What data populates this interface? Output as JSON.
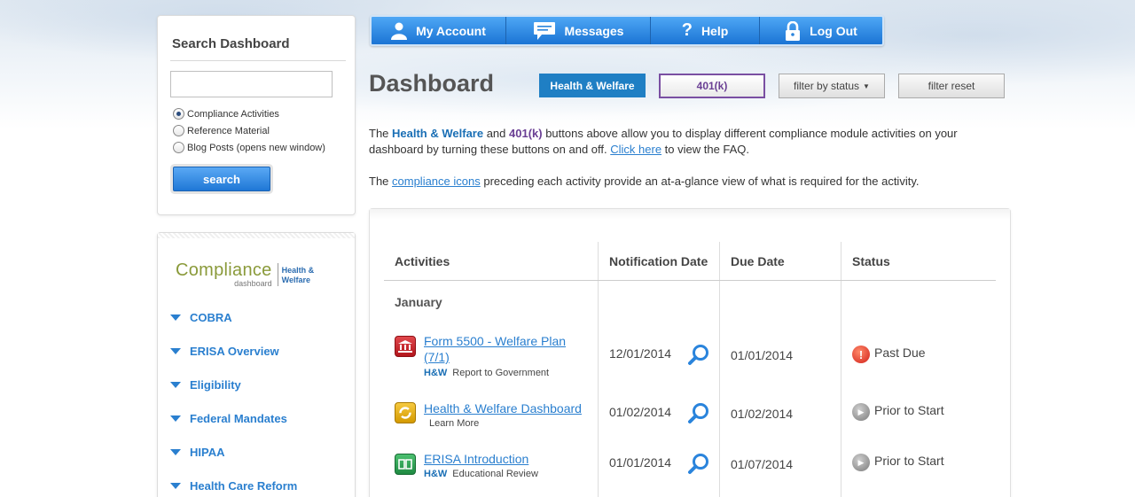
{
  "search": {
    "title": "Search Dashboard",
    "input_value": "",
    "options": [
      {
        "label": "Compliance Activities",
        "checked": true
      },
      {
        "label": "Reference Material",
        "checked": false
      },
      {
        "label": "Blog Posts (opens new window)",
        "checked": false
      }
    ],
    "button": "search"
  },
  "logo": {
    "compliance": "Compliance",
    "dashboard": "dashboard",
    "hw_line1": "Health &",
    "hw_line2": "Welfare"
  },
  "sidebar": {
    "items": [
      "COBRA",
      "ERISA Overview",
      "Eligibility",
      "Federal Mandates",
      "HIPAA",
      "Health Care Reform"
    ]
  },
  "menu": {
    "items": [
      {
        "label": "My Account",
        "icon": "user-icon"
      },
      {
        "label": "Messages",
        "icon": "speech-bubble-icon"
      },
      {
        "label": "Help",
        "icon": "question-icon"
      },
      {
        "label": "Log Out",
        "icon": "lock-icon"
      }
    ]
  },
  "page": {
    "title": "Dashboard",
    "filters": {
      "hw": "Health & Welfare",
      "k401": "401(k)",
      "status": "filter by status",
      "reset": "filter reset"
    },
    "intro": {
      "t1": "The ",
      "hw": "Health & Welfare",
      "t2": " and ",
      "k401": "401(k)",
      "t3": " buttons above allow you to display different compliance module activities on your dashboard by turning these buttons on and off. ",
      "link": "Click here",
      "t4": " to view the FAQ."
    },
    "icons_para": {
      "t1": "The ",
      "link": "compliance icons",
      "t2": " preceding each activity provide an at-a-glance view of what is required for the activity."
    }
  },
  "table": {
    "headers": [
      "Activities",
      "Notification Date",
      "Due Date",
      "Status"
    ],
    "month": "January",
    "rows": [
      {
        "title": "Form 5500 - Welfare Plan (7/1)",
        "tag": "H&W",
        "sub": "Report to Government",
        "icon": "government-building-icon",
        "icon_color": "#c0272d",
        "notification": "12/01/2014",
        "due": "01/01/2014",
        "status": "Past Due",
        "status_icon": "alert-icon"
      },
      {
        "title": "Health & Welfare Dashboard",
        "tag": "",
        "sub": "Learn More",
        "icon": "refresh-cycle-icon",
        "icon_color": "#e0a400",
        "notification": "01/02/2014",
        "due": "01/02/2014",
        "status": "Prior to Start",
        "status_icon": "next-icon"
      },
      {
        "title": "ERISA Introduction",
        "tag": "H&W",
        "sub": "Educational Review",
        "icon": "book-icon",
        "icon_color": "#2f9a4f",
        "notification": "01/01/2014",
        "due": "01/07/2014",
        "status": "Prior to Start",
        "status_icon": "next-icon"
      }
    ]
  },
  "colors": {
    "accent_blue": "#1f7fc4",
    "purple": "#6a3f94",
    "link": "#2a7fcf"
  }
}
